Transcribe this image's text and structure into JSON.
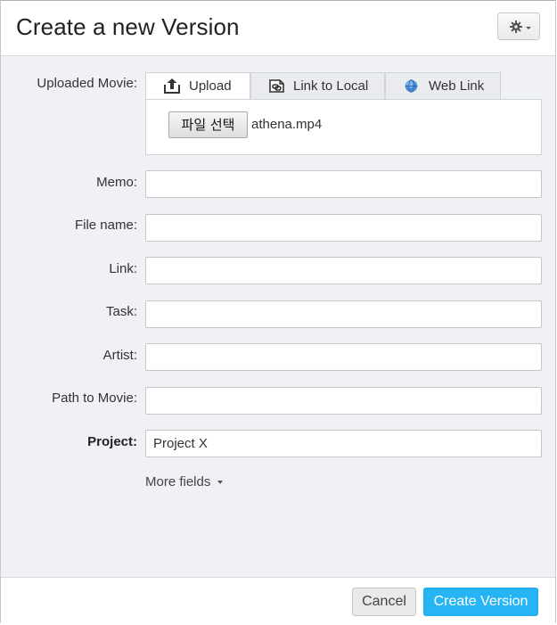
{
  "dialog": {
    "title": "Create a new Version",
    "settings_icon": "gear-icon"
  },
  "form": {
    "uploaded_movie_label": "Uploaded Movie:",
    "tabs": [
      {
        "label": "Upload",
        "icon": "upload-icon",
        "active": true
      },
      {
        "label": "Link to Local",
        "icon": "link-local-icon",
        "active": false
      },
      {
        "label": "Web Link",
        "icon": "globe-icon",
        "active": false
      }
    ],
    "file_button_label": "파일 선택",
    "file_name": "athena.mp4",
    "fields": [
      {
        "label": "Memo:",
        "value": ""
      },
      {
        "label": "File name:",
        "value": ""
      },
      {
        "label": "Link:",
        "value": ""
      },
      {
        "label": "Task:",
        "value": ""
      },
      {
        "label": "Artist:",
        "value": ""
      },
      {
        "label": "Path to Movie:",
        "value": ""
      },
      {
        "label": "Project:",
        "value": "Project X"
      }
    ],
    "more_fields_label": "More fields"
  },
  "footer": {
    "cancel_label": "Cancel",
    "create_label": "Create Version"
  },
  "colors": {
    "primary": "#26b4f5",
    "body_bg": "#f0f1f5"
  }
}
